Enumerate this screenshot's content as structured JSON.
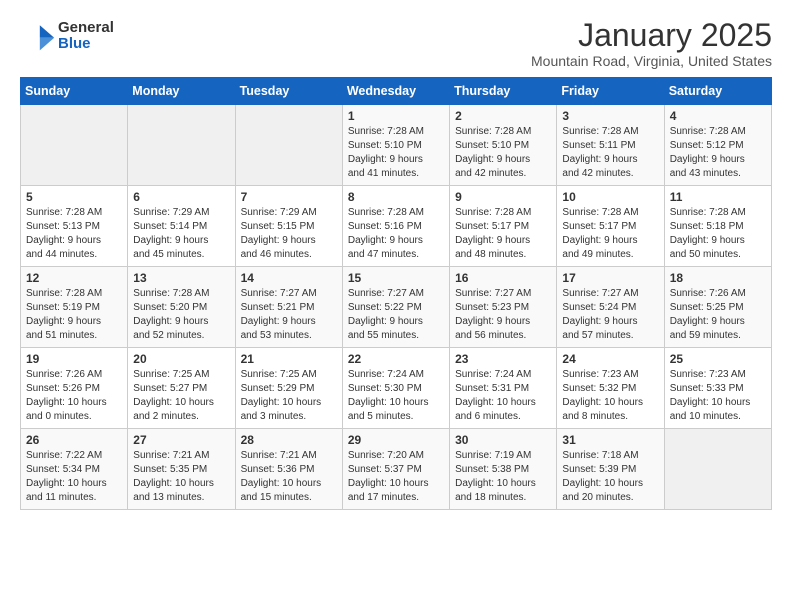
{
  "logo": {
    "general": "General",
    "blue": "Blue"
  },
  "title": "January 2025",
  "subtitle": "Mountain Road, Virginia, United States",
  "days_header": [
    "Sunday",
    "Monday",
    "Tuesday",
    "Wednesday",
    "Thursday",
    "Friday",
    "Saturday"
  ],
  "weeks": [
    [
      {
        "day": "",
        "info": ""
      },
      {
        "day": "",
        "info": ""
      },
      {
        "day": "",
        "info": ""
      },
      {
        "day": "1",
        "info": "Sunrise: 7:28 AM\nSunset: 5:10 PM\nDaylight: 9 hours\nand 41 minutes."
      },
      {
        "day": "2",
        "info": "Sunrise: 7:28 AM\nSunset: 5:10 PM\nDaylight: 9 hours\nand 42 minutes."
      },
      {
        "day": "3",
        "info": "Sunrise: 7:28 AM\nSunset: 5:11 PM\nDaylight: 9 hours\nand 42 minutes."
      },
      {
        "day": "4",
        "info": "Sunrise: 7:28 AM\nSunset: 5:12 PM\nDaylight: 9 hours\nand 43 minutes."
      }
    ],
    [
      {
        "day": "5",
        "info": "Sunrise: 7:28 AM\nSunset: 5:13 PM\nDaylight: 9 hours\nand 44 minutes."
      },
      {
        "day": "6",
        "info": "Sunrise: 7:29 AM\nSunset: 5:14 PM\nDaylight: 9 hours\nand 45 minutes."
      },
      {
        "day": "7",
        "info": "Sunrise: 7:29 AM\nSunset: 5:15 PM\nDaylight: 9 hours\nand 46 minutes."
      },
      {
        "day": "8",
        "info": "Sunrise: 7:28 AM\nSunset: 5:16 PM\nDaylight: 9 hours\nand 47 minutes."
      },
      {
        "day": "9",
        "info": "Sunrise: 7:28 AM\nSunset: 5:17 PM\nDaylight: 9 hours\nand 48 minutes."
      },
      {
        "day": "10",
        "info": "Sunrise: 7:28 AM\nSunset: 5:17 PM\nDaylight: 9 hours\nand 49 minutes."
      },
      {
        "day": "11",
        "info": "Sunrise: 7:28 AM\nSunset: 5:18 PM\nDaylight: 9 hours\nand 50 minutes."
      }
    ],
    [
      {
        "day": "12",
        "info": "Sunrise: 7:28 AM\nSunset: 5:19 PM\nDaylight: 9 hours\nand 51 minutes."
      },
      {
        "day": "13",
        "info": "Sunrise: 7:28 AM\nSunset: 5:20 PM\nDaylight: 9 hours\nand 52 minutes."
      },
      {
        "day": "14",
        "info": "Sunrise: 7:27 AM\nSunset: 5:21 PM\nDaylight: 9 hours\nand 53 minutes."
      },
      {
        "day": "15",
        "info": "Sunrise: 7:27 AM\nSunset: 5:22 PM\nDaylight: 9 hours\nand 55 minutes."
      },
      {
        "day": "16",
        "info": "Sunrise: 7:27 AM\nSunset: 5:23 PM\nDaylight: 9 hours\nand 56 minutes."
      },
      {
        "day": "17",
        "info": "Sunrise: 7:27 AM\nSunset: 5:24 PM\nDaylight: 9 hours\nand 57 minutes."
      },
      {
        "day": "18",
        "info": "Sunrise: 7:26 AM\nSunset: 5:25 PM\nDaylight: 9 hours\nand 59 minutes."
      }
    ],
    [
      {
        "day": "19",
        "info": "Sunrise: 7:26 AM\nSunset: 5:26 PM\nDaylight: 10 hours\nand 0 minutes."
      },
      {
        "day": "20",
        "info": "Sunrise: 7:25 AM\nSunset: 5:27 PM\nDaylight: 10 hours\nand 2 minutes."
      },
      {
        "day": "21",
        "info": "Sunrise: 7:25 AM\nSunset: 5:29 PM\nDaylight: 10 hours\nand 3 minutes."
      },
      {
        "day": "22",
        "info": "Sunrise: 7:24 AM\nSunset: 5:30 PM\nDaylight: 10 hours\nand 5 minutes."
      },
      {
        "day": "23",
        "info": "Sunrise: 7:24 AM\nSunset: 5:31 PM\nDaylight: 10 hours\nand 6 minutes."
      },
      {
        "day": "24",
        "info": "Sunrise: 7:23 AM\nSunset: 5:32 PM\nDaylight: 10 hours\nand 8 minutes."
      },
      {
        "day": "25",
        "info": "Sunrise: 7:23 AM\nSunset: 5:33 PM\nDaylight: 10 hours\nand 10 minutes."
      }
    ],
    [
      {
        "day": "26",
        "info": "Sunrise: 7:22 AM\nSunset: 5:34 PM\nDaylight: 10 hours\nand 11 minutes."
      },
      {
        "day": "27",
        "info": "Sunrise: 7:21 AM\nSunset: 5:35 PM\nDaylight: 10 hours\nand 13 minutes."
      },
      {
        "day": "28",
        "info": "Sunrise: 7:21 AM\nSunset: 5:36 PM\nDaylight: 10 hours\nand 15 minutes."
      },
      {
        "day": "29",
        "info": "Sunrise: 7:20 AM\nSunset: 5:37 PM\nDaylight: 10 hours\nand 17 minutes."
      },
      {
        "day": "30",
        "info": "Sunrise: 7:19 AM\nSunset: 5:38 PM\nDaylight: 10 hours\nand 18 minutes."
      },
      {
        "day": "31",
        "info": "Sunrise: 7:18 AM\nSunset: 5:39 PM\nDaylight: 10 hours\nand 20 minutes."
      },
      {
        "day": "",
        "info": ""
      }
    ]
  ]
}
